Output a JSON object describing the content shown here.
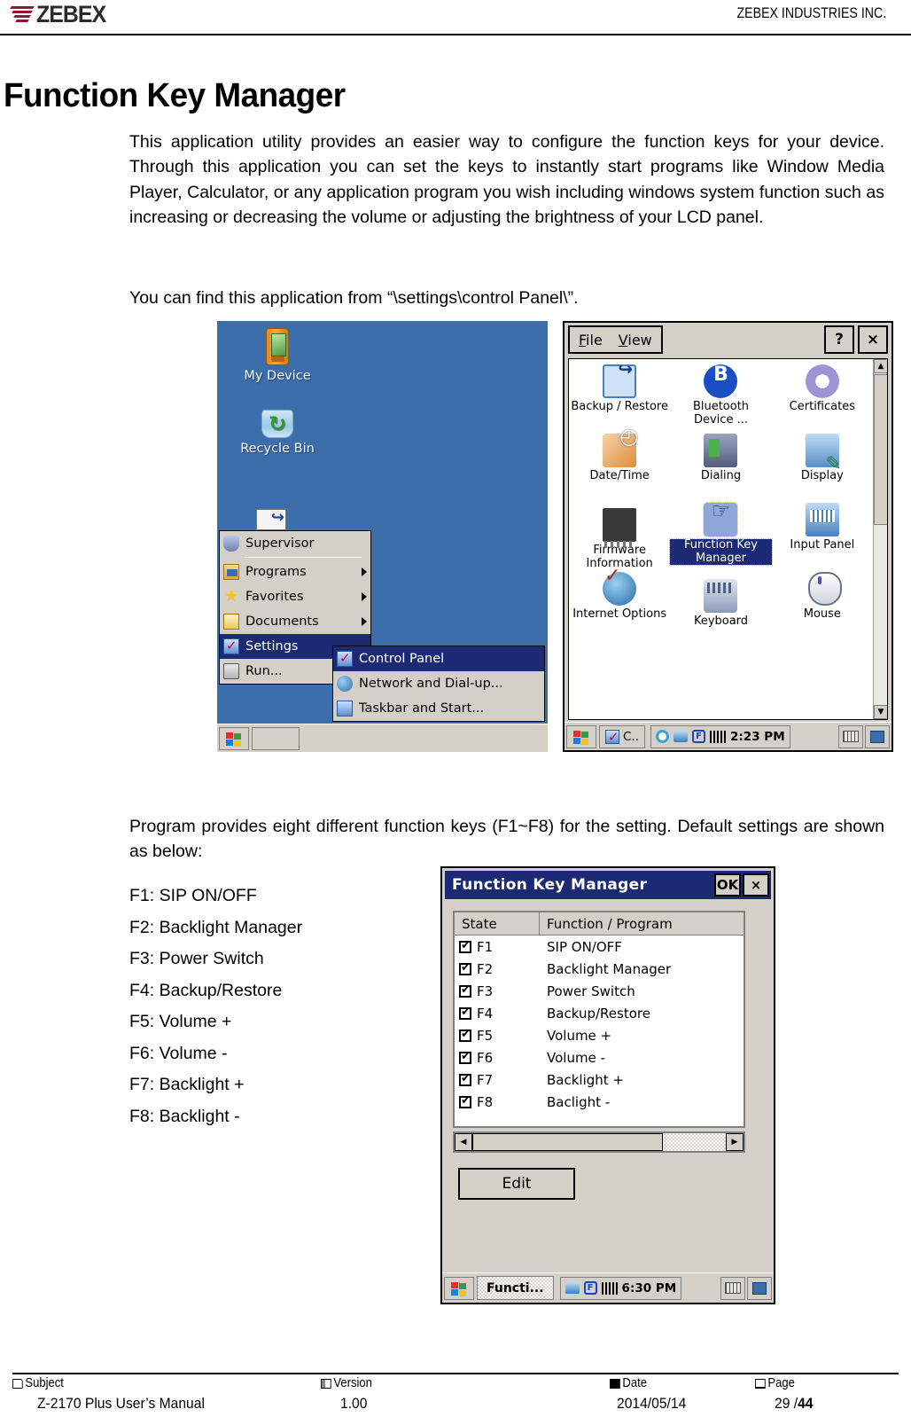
{
  "header": {
    "logo_text": "ZEBEX",
    "company": "ZEBEX INDUSTRIES INC."
  },
  "document": {
    "title": "Function Key Manager",
    "paragraph_intro": "This application utility provides an easier way to configure the function keys for your device. Through this application you can set the keys to instantly start programs like Window Media Player, Calculator, or any application program you wish including windows system function such as increasing or decreasing the volume or adjusting the brightness of your LCD panel.",
    "paragraph_find": "You can find this application from “\\settings\\control Panel\\”.",
    "paragraph_program": "Program provides eight different function keys (F1~F8) for the setting. Default settings are shown as below:",
    "key_list": [
      "F1: SIP ON/OFF",
      "F2: Backlight Manager",
      "F3: Power Switch",
      "F4: Backup/Restore",
      "F5: Volume +",
      "F6: Volume -",
      "F7: Backlight +",
      "F8: Backlight -"
    ]
  },
  "desktop": {
    "icons": [
      {
        "label": "My Device",
        "icon": "handheld-device-icon"
      },
      {
        "label": "Recycle Bin",
        "icon": "recycle-bin-icon"
      }
    ],
    "start_menu": [
      {
        "label": "Supervisor",
        "accel": "S",
        "icon": "supervisor-icon",
        "arrow": false,
        "selected": false
      },
      {
        "label": "Programs",
        "accel": "P",
        "icon": "programs-icon",
        "arrow": true,
        "selected": false
      },
      {
        "label": "Favorites",
        "accel": "a",
        "icon": "favorites-icon",
        "arrow": true,
        "selected": false
      },
      {
        "label": "Documents",
        "accel": "D",
        "icon": "documents-icon",
        "arrow": true,
        "selected": false
      },
      {
        "label": "Settings",
        "accel": "S",
        "icon": "settings-icon",
        "arrow": false,
        "selected": true
      },
      {
        "label": "Run...",
        "accel": "R",
        "icon": "run-icon",
        "arrow": false,
        "selected": false
      }
    ],
    "submenu": [
      {
        "label": "Control Panel",
        "icon": "control-panel-icon",
        "selected": true
      },
      {
        "label": "Network and Dial-up...",
        "icon": "network-icon",
        "selected": false
      },
      {
        "label": "Taskbar and Start...",
        "icon": "taskbar-icon",
        "selected": false
      }
    ],
    "taskbar": {
      "start_icon": "windows-flag-icon"
    }
  },
  "control_panel": {
    "menu": [
      {
        "label": "File",
        "accel": "F"
      },
      {
        "label": "View",
        "accel": "V"
      }
    ],
    "window_buttons": [
      {
        "label": "?",
        "name": "help-button"
      },
      {
        "label": "×",
        "name": "close-button"
      }
    ],
    "items": [
      {
        "label": "Backup / Restore",
        "icon": "backup-restore-icon",
        "selected": false
      },
      {
        "label": "Bluetooth Device ...",
        "icon": "bluetooth-icon",
        "selected": false
      },
      {
        "label": "Certificates",
        "icon": "certificates-icon",
        "selected": false
      },
      {
        "label": "Date/Time",
        "icon": "date-time-icon",
        "selected": false
      },
      {
        "label": "Dialing",
        "icon": "dialing-icon",
        "selected": false
      },
      {
        "label": "Display",
        "icon": "display-icon",
        "selected": false
      },
      {
        "label": "Firmware Information",
        "icon": "firmware-icon",
        "selected": false
      },
      {
        "label": "Function Key Manager",
        "icon": "function-key-icon",
        "selected": true
      },
      {
        "label": "Input Panel",
        "icon": "input-panel-icon",
        "selected": false
      },
      {
        "label": "Internet Options",
        "icon": "internet-options-icon",
        "selected": false
      },
      {
        "label": "Keyboard",
        "icon": "keyboard-icon",
        "selected": false
      },
      {
        "label": "Mouse",
        "icon": "mouse-icon",
        "selected": false
      }
    ],
    "taskbar": {
      "task_button": "C..",
      "clock": "2:23 PM"
    }
  },
  "fkm_dialog": {
    "title": "Function Key Manager",
    "ok_label": "OK",
    "close_label": "×",
    "columns": [
      "State",
      "Function / Program"
    ],
    "rows": [
      {
        "key": "F1",
        "program": "SIP ON/OFF",
        "checked": true
      },
      {
        "key": "F2",
        "program": "Backlight Manager",
        "checked": true
      },
      {
        "key": "F3",
        "program": "Power Switch",
        "checked": true
      },
      {
        "key": "F4",
        "program": "Backup/Restore",
        "checked": true
      },
      {
        "key": "F5",
        "program": "Volume +",
        "checked": true
      },
      {
        "key": "F6",
        "program": "Volume -",
        "checked": true
      },
      {
        "key": "F7",
        "program": "Backlight +",
        "checked": true
      },
      {
        "key": "F8",
        "program": "Baclight -",
        "checked": true
      }
    ],
    "edit_label": "Edit",
    "taskbar": {
      "task_button": "Functi...",
      "clock": "6:30 PM"
    }
  },
  "footer": {
    "subject_label": "Subject",
    "subject_value": "Z-2170 Plus User’s Manual",
    "version_label": "Version",
    "version_value": "1.00",
    "date_label": "Date",
    "date_value": "2014/05/14",
    "page_label": "Page",
    "page_current": "29 / ",
    "page_total": "44"
  }
}
